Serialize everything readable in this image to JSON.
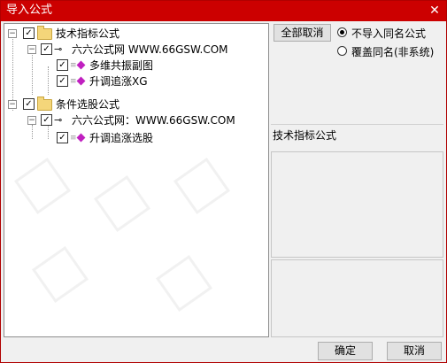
{
  "window": {
    "title": "导入公式",
    "close_glyph": "✕"
  },
  "tree": {
    "nodes": [
      {
        "label": "技术指标公式",
        "checked": true
      },
      {
        "label": "六六公式网 WWW.66GSW.COM",
        "checked": true
      },
      {
        "label": "多维共振副图",
        "checked": true
      },
      {
        "label": "升调追涨XG",
        "checked": true
      },
      {
        "label": "条件选股公式",
        "checked": true
      },
      {
        "label": "六六公式网：WWW.66GSW.COM",
        "checked": true
      },
      {
        "label": "升调追涨选股",
        "checked": true
      }
    ],
    "collapse_glyph": "−",
    "check_glyph": "✓"
  },
  "options": {
    "deselect_all_label": "全部取消",
    "radio_no_import_label": "不导入同名公式",
    "radio_overwrite_label": "覆盖同名(非系统)",
    "selected": "不导入同名公式"
  },
  "info": {
    "category_label": "技术指标公式"
  },
  "footer": {
    "ok_label": "确定",
    "cancel_label": "取消"
  },
  "colors": {
    "titlebar": "#cc0000",
    "leaf_icon": "#c020c0",
    "folder": "#f4d67a"
  }
}
